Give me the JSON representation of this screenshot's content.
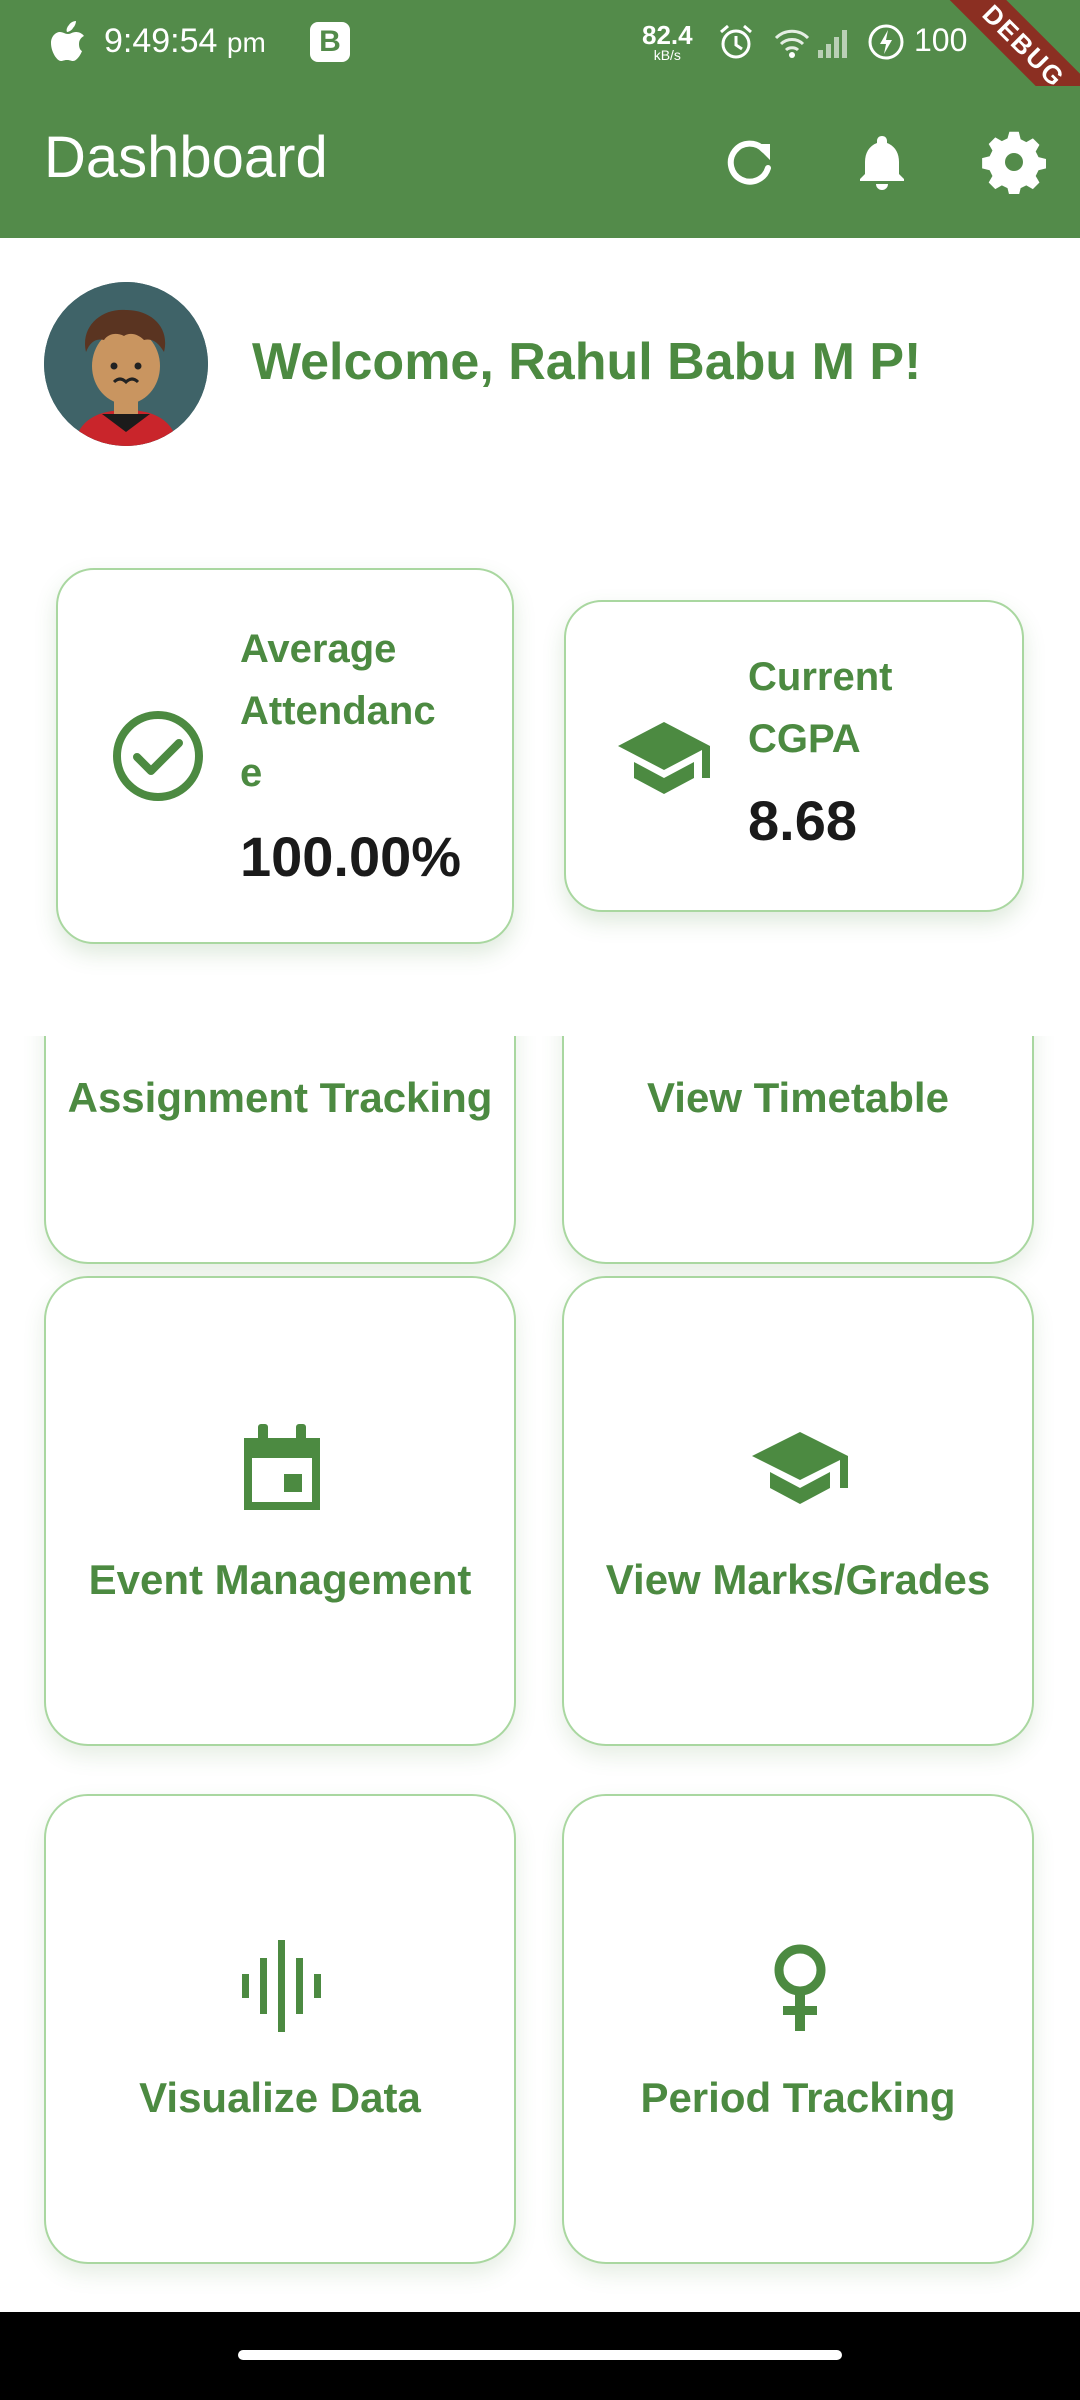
{
  "status_bar": {
    "time": "9:49:54",
    "ampm": "pm",
    "badge": "B",
    "net_speed": "82.4",
    "net_unit": "kB/s",
    "battery": "100"
  },
  "debug_banner": "DEBUG",
  "app_bar": {
    "title": "Dashboard",
    "icons": [
      "refresh-icon",
      "bell-icon",
      "gear-icon"
    ]
  },
  "welcome": {
    "text": "Welcome, Rahul Babu M P!"
  },
  "summary": {
    "attendance": {
      "label_lines": [
        "Average",
        "Attendanc",
        "e"
      ],
      "value": "100.00%",
      "icon": "check-circle-icon"
    },
    "cgpa": {
      "label_lines": [
        "Current",
        "CGPA"
      ],
      "value": "8.68",
      "icon": "graduation-cap-icon"
    }
  },
  "features": [
    {
      "label": "Assignment Tracking",
      "icon": "assignment-icon"
    },
    {
      "label": "View Timetable",
      "icon": "timetable-icon"
    },
    {
      "label": "Event Management",
      "icon": "calendar-icon"
    },
    {
      "label": "View Marks/Grades",
      "icon": "graduation-cap-icon"
    },
    {
      "label": "Visualize Data",
      "icon": "graphic-eq-icon"
    },
    {
      "label": "Period Tracking",
      "icon": "female-icon"
    }
  ],
  "colors": {
    "primary": "#538b4a",
    "accent_text": "#4c8a41",
    "card_border": "#a9d7a0",
    "debug": "#8b2f22"
  }
}
